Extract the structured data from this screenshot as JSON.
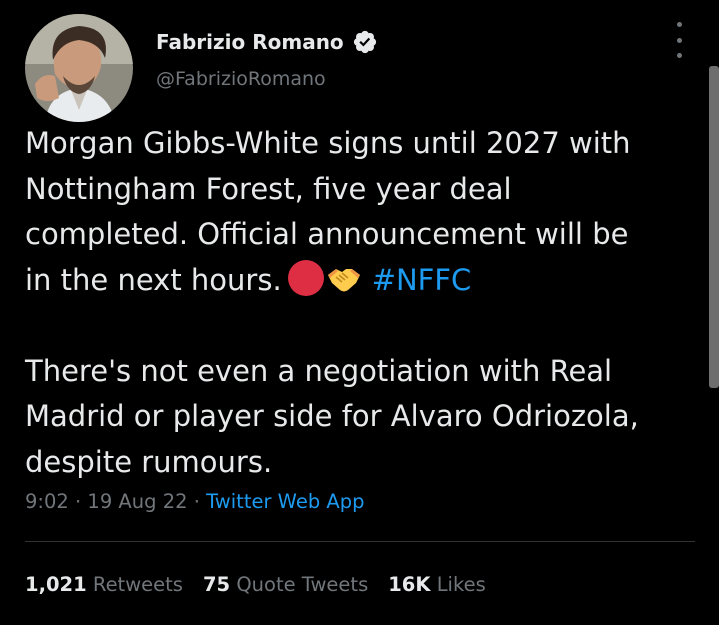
{
  "author": {
    "display_name": "Fabrizio Romano",
    "handle": "@FabrizioRomano",
    "verified_icon": "verified-badge-icon",
    "avatar_icon": "profile-photo"
  },
  "more_icon": "more-options-icon",
  "tweet": {
    "line1": "Morgan Gibbs-White signs until 2027 with",
    "line2": "Nottingham Forest, five year deal",
    "line3": "completed. Official announcement will be",
    "line4": "in the next hours.",
    "emoji_1": "red-circle-emoji",
    "emoji_2": "handshake-emoji",
    "hashtag": "#NFFC",
    "line5": "There's not even a negotiation with Real",
    "line6": "Madrid or player side for Alvaro Odriozola,",
    "line7": "despite rumours."
  },
  "meta": {
    "time": "9:02",
    "separator": " · ",
    "date": "19 Aug 22",
    "source": "Twitter Web App"
  },
  "stats": {
    "retweets_count": "1,021",
    "retweets_label": "Retweets",
    "quotes_count": "75",
    "quotes_label": "Quote Tweets",
    "likes_count": "16K",
    "likes_label": "Likes"
  },
  "colors": {
    "background": "#000000",
    "text_primary": "#e7e9ea",
    "text_secondary": "#71767b",
    "accent_blue": "#1d9bf0",
    "red_circle": "#dd2e44"
  }
}
